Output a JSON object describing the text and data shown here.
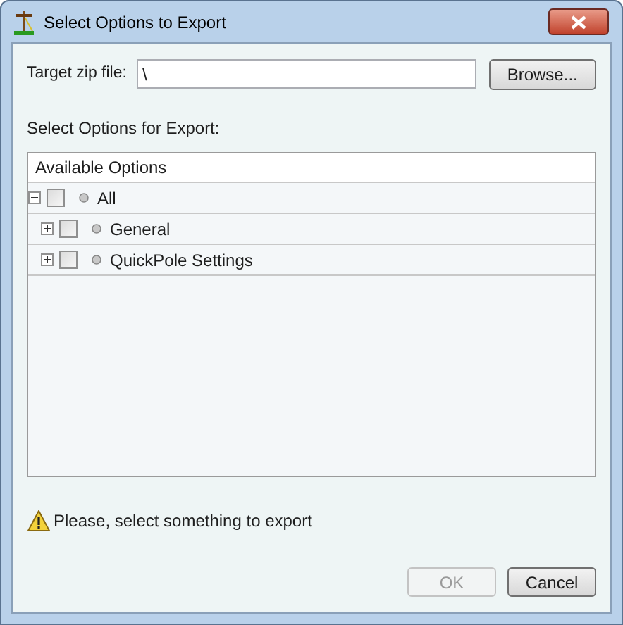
{
  "window": {
    "title": "Select Options to Export"
  },
  "target": {
    "label": "Target zip file:",
    "value": "\\",
    "button": "Browse..."
  },
  "options_label": "Select Options for Export:",
  "tree": {
    "header": "Available Options",
    "items": [
      {
        "label": "All",
        "expanded": true,
        "checked": false,
        "children": [
          {
            "label": "General",
            "expanded": false,
            "checked": false
          },
          {
            "label": "QuickPole Settings",
            "expanded": false,
            "checked": false
          }
        ]
      }
    ]
  },
  "message": "Please, select something to export",
  "buttons": [
    {
      "label": "OK",
      "disabled": true
    },
    {
      "label": "Cancel",
      "disabled": false
    }
  ]
}
